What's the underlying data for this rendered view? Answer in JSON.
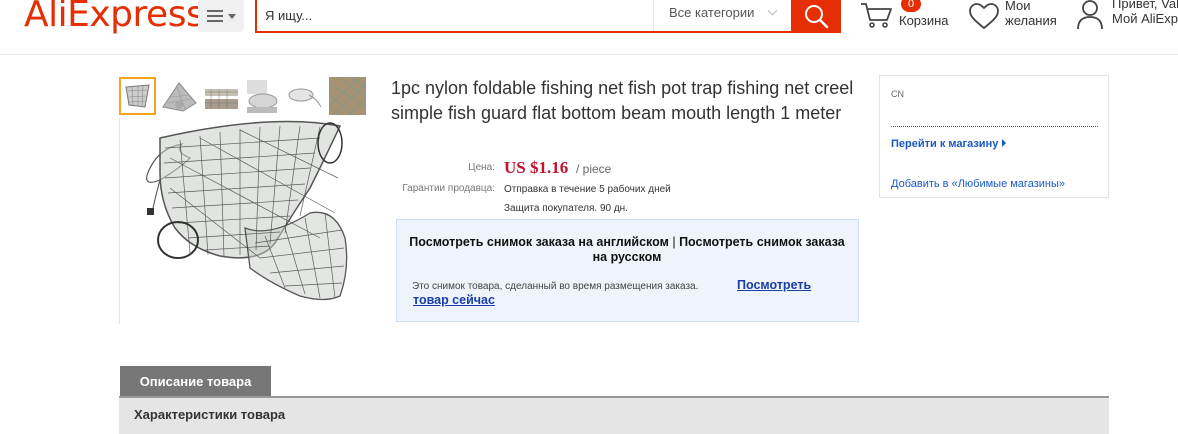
{
  "header": {
    "logo": "AliExpress",
    "search": {
      "placeholder": "Я ищу...",
      "category": "Все категории"
    },
    "cart": {
      "label": "Корзина",
      "count": "0"
    },
    "wishlist": {
      "label": "Мои желания"
    },
    "account": {
      "greeting": "Привет, Val",
      "link": "Мой AliExp"
    }
  },
  "gallery": {
    "thumbnails": [
      "thumb-1",
      "thumb-2",
      "thumb-3",
      "thumb-4",
      "thumb-5",
      "thumb-6"
    ],
    "active_index": 0
  },
  "product": {
    "title": "1pc nylon foldable fishing net fish pot trap fishing net creel simple fish guard flat bottom beam mouth length 1 meter",
    "price_label": "Цена:",
    "price": "US $1.16",
    "price_unit": "/ piece",
    "guarantee_label": "Гарантии продавца:",
    "guarantee_shipping": "Отправка в течение 5 рабочих дней",
    "guarantee_protection": "Защита покупателя. 90 дн."
  },
  "snapshot": {
    "view_english": "Посмотреть снимок заказа на английском",
    "separator": "|",
    "view_russian": "Посмотреть снимок заказа на русском",
    "note": "Это снимок товара, сделанный во время размещения заказа.",
    "view_now": "Посмотреть товар сейчас"
  },
  "store": {
    "country": "CN",
    "visit": "Перейти к магазину",
    "favorite": "Добавить в «Любимые магазины»"
  },
  "tabs": {
    "description": "Описание товара",
    "specs_title": "Характеристики товара"
  },
  "colors": {
    "brand": "#e62e04",
    "price": "#c8102e",
    "link": "#1a58c4",
    "thumb_active": "#f7a31c"
  }
}
